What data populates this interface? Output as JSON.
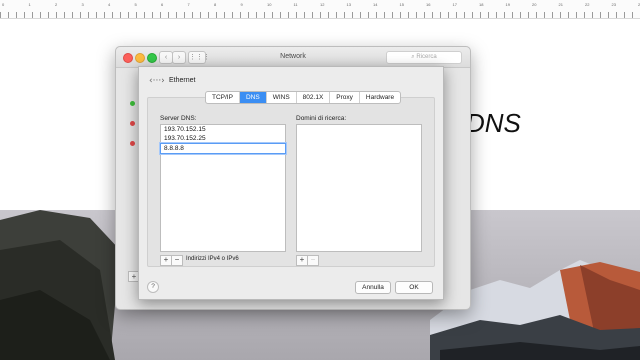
{
  "background": {
    "ruler_numbers": [
      "0",
      "1",
      "2",
      "3",
      "4",
      "5",
      "6",
      "7",
      "8",
      "9",
      "10",
      "11",
      "12",
      "13",
      "14",
      "15",
      "16",
      "17",
      "18",
      "19",
      "20",
      "21",
      "22",
      "23",
      "24",
      "25"
    ],
    "document_heading": "DNS"
  },
  "window": {
    "title": "Network",
    "search_placeholder": "Ricerca",
    "nav_back": "‹",
    "nav_forward": "›",
    "grid": "⋮⋮⋮",
    "add_button": "+"
  },
  "sheet": {
    "interface_name": "Ethernet",
    "interface_icon": "‹···›",
    "tabs": [
      {
        "label": "TCP/IP",
        "active": false
      },
      {
        "label": "DNS",
        "active": true
      },
      {
        "label": "WINS",
        "active": false
      },
      {
        "label": "802.1X",
        "active": false
      },
      {
        "label": "Proxy",
        "active": false
      },
      {
        "label": "Hardware",
        "active": false
      }
    ],
    "dns_servers": {
      "label": "Server DNS:",
      "entries": [
        "193.70.152.15",
        "193.70.152.25",
        "8.8.8.8"
      ],
      "editing_index": 2,
      "add": "+",
      "remove": "−",
      "hint": "Indirizzi IPv4 o IPv6"
    },
    "search_domains": {
      "label": "Domini di ricerca:",
      "entries": [],
      "add": "+",
      "remove": "−"
    },
    "help": "?",
    "cancel_label": "Annulla",
    "ok_label": "OK"
  },
  "colors": {
    "accent": "#3b8ef3",
    "status_green": "#3dbf3a",
    "status_red": "#e04848"
  }
}
